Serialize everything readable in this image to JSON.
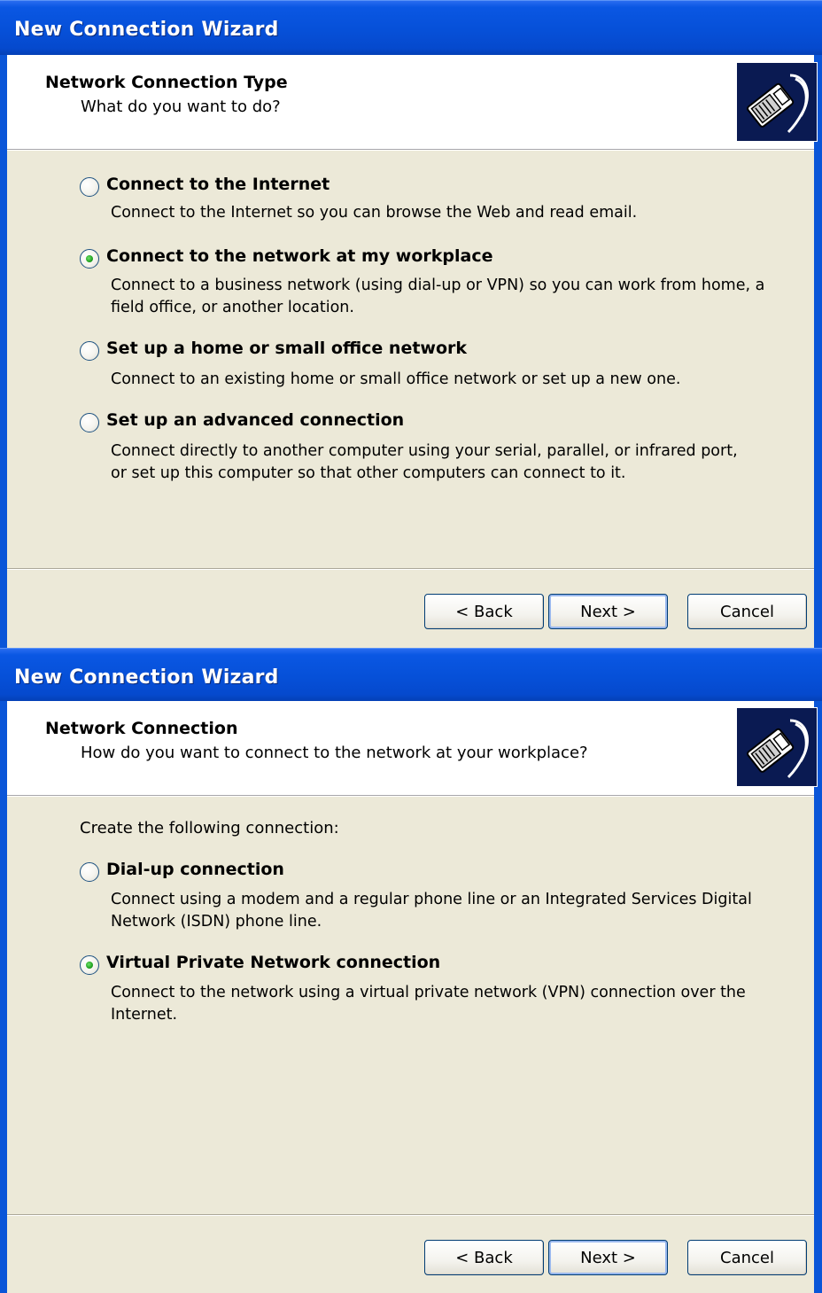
{
  "wizard1": {
    "title": "New Connection Wizard",
    "header_title": "Network Connection Type",
    "header_subtitle": "What do you want to do?",
    "icon": "network-cable-icon",
    "options": [
      {
        "label": "Connect to the Internet",
        "description": "Connect to the Internet so you can browse the Web and read email.",
        "selected": false
      },
      {
        "label": "Connect to the network at my workplace",
        "description": "Connect to a business network (using dial-up or VPN) so you can work from home, a field office, or another location.",
        "selected": true
      },
      {
        "label": "Set up a home or small office network",
        "description": "Connect to an existing home or small office network or set up a new one.",
        "selected": false
      },
      {
        "label": "Set up an advanced connection",
        "description": "Connect directly to another computer using your serial, parallel, or infrared port, or set up this computer so that other computers can connect to it.",
        "selected": false
      }
    ],
    "buttons": {
      "back": "< Back",
      "next": "Next >",
      "cancel": "Cancel"
    }
  },
  "wizard2": {
    "title": "New Connection Wizard",
    "header_title": "Network Connection",
    "header_subtitle": "How do you want to connect to the network at your workplace?",
    "icon": "network-cable-icon",
    "intro": "Create the following connection:",
    "options": [
      {
        "label": "Dial-up connection",
        "description": "Connect using a modem and a regular phone line or an Integrated Services Digital Network (ISDN) phone line.",
        "selected": false
      },
      {
        "label": "Virtual Private Network connection",
        "description": "Connect to the network using a virtual private network (VPN) connection over the Internet.",
        "selected": true
      }
    ],
    "buttons": {
      "back": "< Back",
      "next": "Next >",
      "cancel": "Cancel"
    }
  },
  "colors": {
    "titlebar": "#0650d8",
    "body": "#ece9d8",
    "radio_selected": "#21a121"
  }
}
